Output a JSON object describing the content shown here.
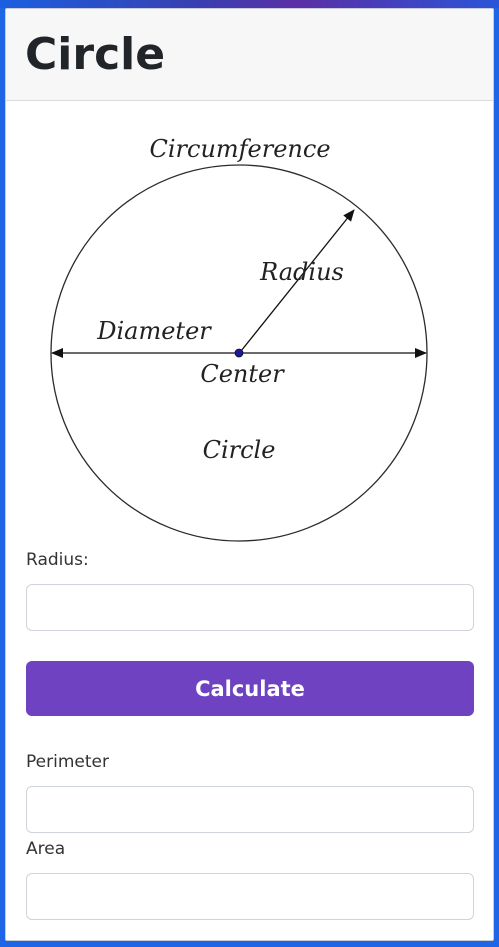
{
  "page": {
    "title": "Circle"
  },
  "figure": {
    "circumference_label": "Circumference",
    "radius_label": "Radius",
    "diameter_label": "Diameter",
    "center_label": "Center",
    "circle_label": "Circle"
  },
  "form": {
    "radius_label": "Radius:",
    "radius_value": "",
    "calculate_label": "Calculate",
    "perimeter_label": "Perimeter",
    "perimeter_value": "",
    "area_label": "Area",
    "area_value": ""
  },
  "colors": {
    "button": "#6f42c1",
    "frame_border": "#1e66e6",
    "center_dot": "#1a1aa0"
  }
}
